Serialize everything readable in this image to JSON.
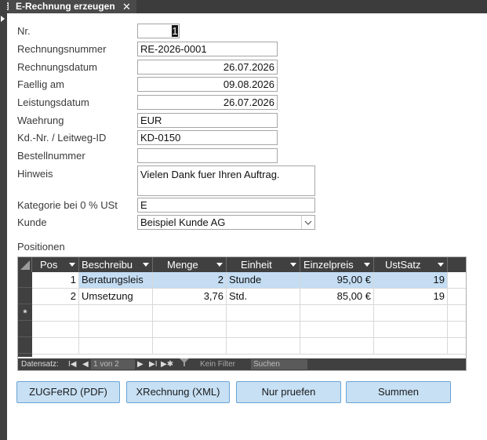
{
  "tab": {
    "title": "E-Rechnung erzeugen",
    "close_glyph": "✕"
  },
  "form": {
    "nr": {
      "label": "Nr.",
      "value": "1"
    },
    "rechnungsnummer": {
      "label": "Rechnungsnummer",
      "value": "RE-2026-0001"
    },
    "rechnungsdatum": {
      "label": "Rechnungsdatum",
      "value": "26.07.2026"
    },
    "faellig": {
      "label": "Faellig am",
      "value": "09.08.2026"
    },
    "leistungsdatum": {
      "label": "Leistungsdatum",
      "value": "26.07.2026"
    },
    "waehrung": {
      "label": "Waehrung",
      "value": "EUR"
    },
    "kdnr": {
      "label": "Kd.-Nr. / Leitweg-ID",
      "value": "KD-0150"
    },
    "bestellnummer": {
      "label": "Bestellnummer",
      "value": ""
    },
    "hinweis": {
      "label": "Hinweis",
      "value": "Vielen Dank fuer Ihren Auftrag."
    },
    "kategorie": {
      "label": "Kategorie bei 0 % USt",
      "value": "E"
    },
    "kunde": {
      "label": "Kunde",
      "value": "Beispiel Kunde AG"
    }
  },
  "positionen": {
    "label": "Positionen",
    "columns": [
      "Pos",
      "Beschreibu",
      "Menge",
      "Einheit",
      "Einzelpreis",
      "UstSatz"
    ],
    "rows": [
      {
        "pos": "1",
        "beschreibung": "Beratungsleis",
        "menge": "2",
        "einheit": "Stunde",
        "einzelpreis": "95,00 €",
        "ustsatz": "19"
      },
      {
        "pos": "2",
        "beschreibung": "Umsetzung",
        "menge": "3,76",
        "einheit": "Std.",
        "einzelpreis": "85,00 €",
        "ustsatz": "19"
      }
    ],
    "new_row_marker": "*",
    "nav": {
      "label": "Datensatz:",
      "first": "I◀",
      "prev": "◀",
      "position": "1 von 2",
      "next": "▶",
      "last": "▶I",
      "new": "▶✱",
      "filter": "Kein Filter",
      "search_placeholder": "Suchen"
    }
  },
  "buttons": {
    "zugferd": "ZUGFeRD (PDF)",
    "xrechnung": "XRechnung (XML)",
    "pruefen": "Nur pruefen",
    "summen": "Summen"
  }
}
